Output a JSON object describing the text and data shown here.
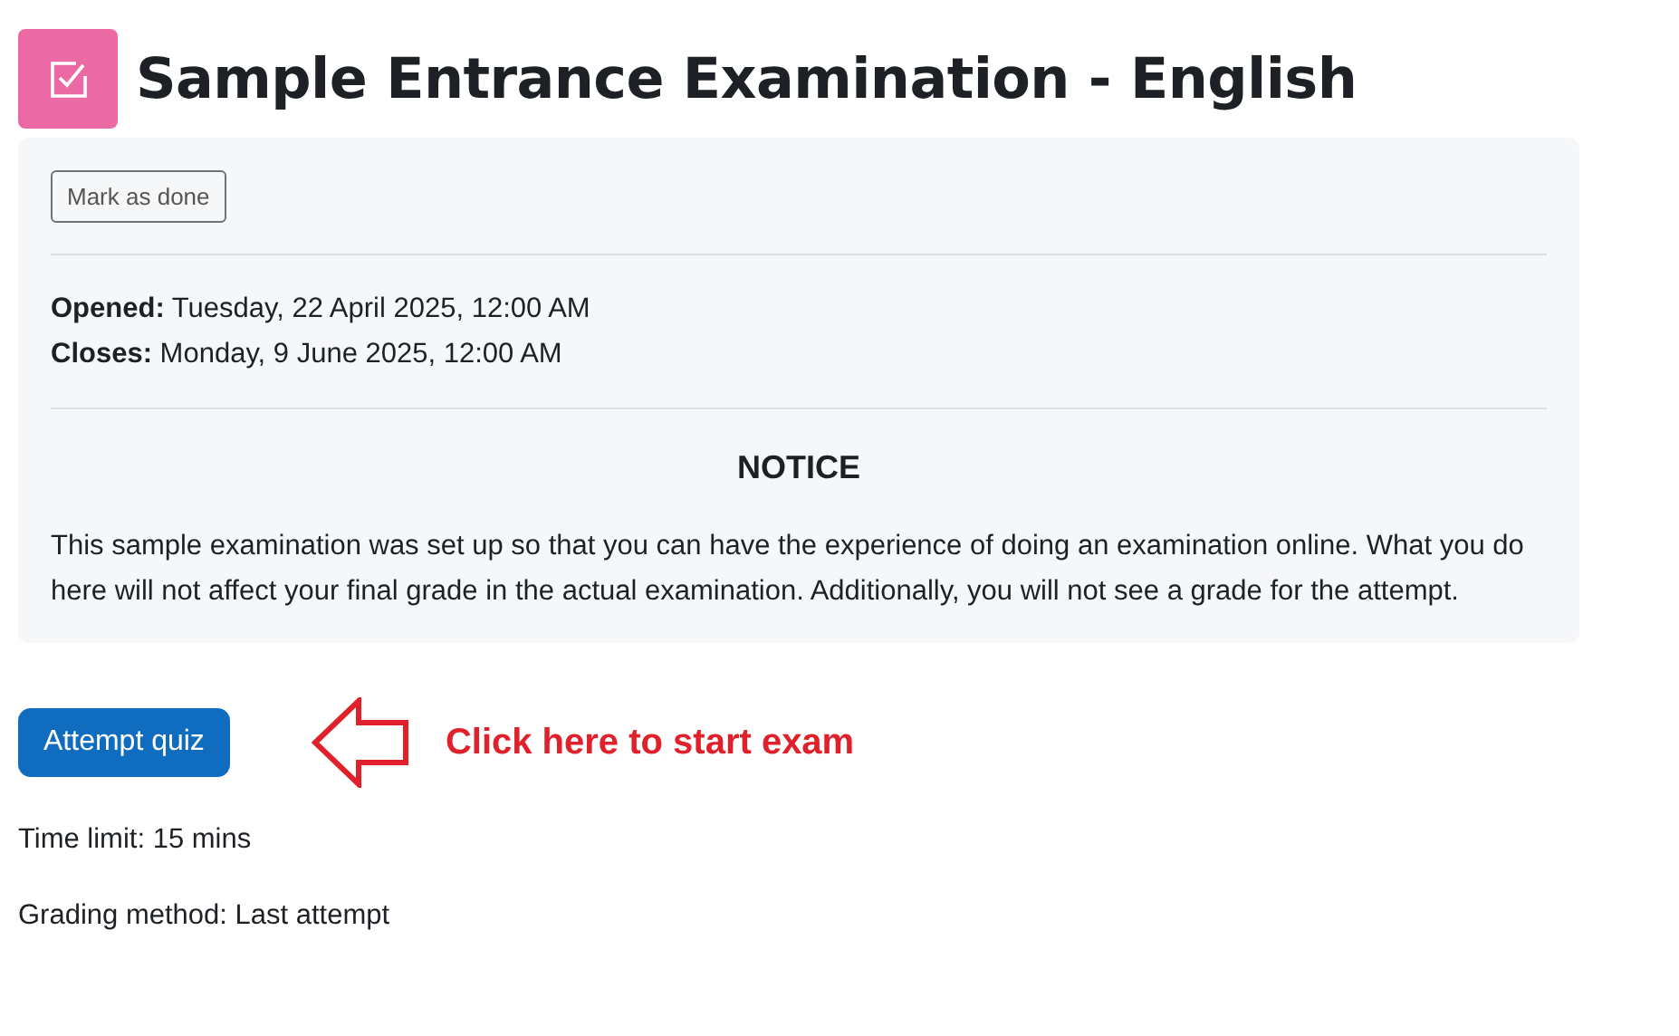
{
  "header": {
    "title": "Sample Entrance Examination - English"
  },
  "card": {
    "mark_button": "Mark as done",
    "dates": [
      "**Opened:** Tuesday, 22 April 2025, 12:00 AM",
      "**Closes:** Monday, 9 June 2025, 12:00 AM"
    ],
    "notice_heading": "NOTICE",
    "notice_text": "This sample examination was set up so that you can have the experience of doing an examination online. What you do here will not affect your final grade in the actual examination. Additionally, you will not see a grade for the attempt."
  },
  "attempt_button": "Attempt quiz",
  "annotation": "Click here to start exam",
  "info": [
    "Time limit: 15 mins",
    "Grading method: Last attempt"
  ]
}
